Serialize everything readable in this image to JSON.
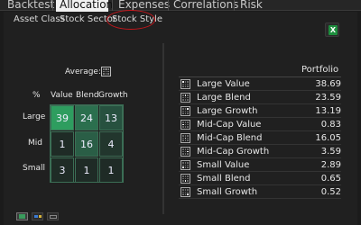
{
  "tabs": [
    "Backtest",
    "Allocation",
    "Expenses",
    "Correlations",
    "Risk"
  ],
  "subtabs": [
    "Asset Class",
    "Stock Sector",
    "Stock Style"
  ],
  "style_box": {
    "average_label": "Average:",
    "corner_label": "%",
    "columns": [
      "Value",
      "Blend",
      "Growth"
    ],
    "rows": [
      "Large",
      "Mid",
      "Small"
    ],
    "cells": [
      [
        "39",
        "24",
        "13"
      ],
      [
        "1",
        "16",
        "4"
      ],
      [
        "3",
        "1",
        "1"
      ]
    ],
    "cell_colors": [
      [
        "#2e9d5f",
        "#2b6f4e",
        "#27513f"
      ],
      [
        "#1f2b26",
        "#2a5e46",
        "#22362d"
      ],
      [
        "#1f2c26",
        "#1f2b26",
        "#1f2b26"
      ]
    ]
  },
  "portfolio": {
    "header": "Portfolio",
    "rows": [
      {
        "label": "Large Value",
        "value": "38.69"
      },
      {
        "label": "Large Blend",
        "value": "23.59"
      },
      {
        "label": "Large Growth",
        "value": "13.19"
      },
      {
        "label": "Mid-Cap Value",
        "value": "0.83"
      },
      {
        "label": "Mid-Cap Blend",
        "value": "16.05"
      },
      {
        "label": "Mid-Cap Growth",
        "value": "3.59"
      },
      {
        "label": "Small Value",
        "value": "2.89"
      },
      {
        "label": "Small Blend",
        "value": "0.65"
      },
      {
        "label": "Small Growth",
        "value": "0.52"
      }
    ]
  },
  "icons": {
    "export": "excel-export-icon",
    "view_buttons": [
      "grid-view-icon",
      "bar-view-icon",
      "table-view-icon"
    ]
  },
  "colors": {
    "accent_ring": "#c4161c",
    "grid_border": "#3b6e55"
  }
}
